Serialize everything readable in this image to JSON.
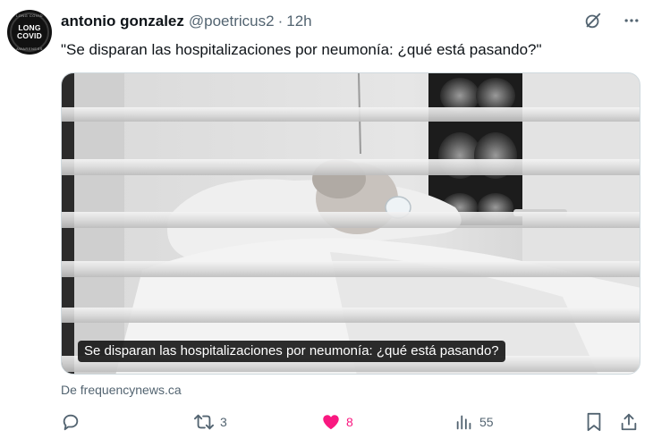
{
  "avatar": {
    "text_line1": "LONG",
    "text_line2": "COVID",
    "ring_top": "LONG COVID",
    "ring_bottom": "AWARENESS"
  },
  "tweet": {
    "author_name": "antonio gonzalez",
    "author_handle": "@poetricus2",
    "separator": "·",
    "timestamp": "12h",
    "text": "\"Se disparan las hospitalizaciones por neumonía: ¿qué está pasando?\""
  },
  "media": {
    "caption": "Se disparan las hospitalizaciones por neumonía: ¿qué está pasando?"
  },
  "link_source": "De frequencynews.ca",
  "actions": {
    "reply_count": "",
    "retweet_count": "3",
    "like_count": "8",
    "views_count": "55"
  },
  "icons": {
    "header": [
      "grok-icon",
      "more-icon"
    ],
    "actions": [
      "reply-icon",
      "retweet-icon",
      "heart-icon",
      "views-icon",
      "bookmark-icon",
      "share-icon"
    ]
  },
  "colors": {
    "text": "#0f1419",
    "secondary_text": "#536471",
    "like": "#f91880",
    "border": "#cfd9de"
  }
}
